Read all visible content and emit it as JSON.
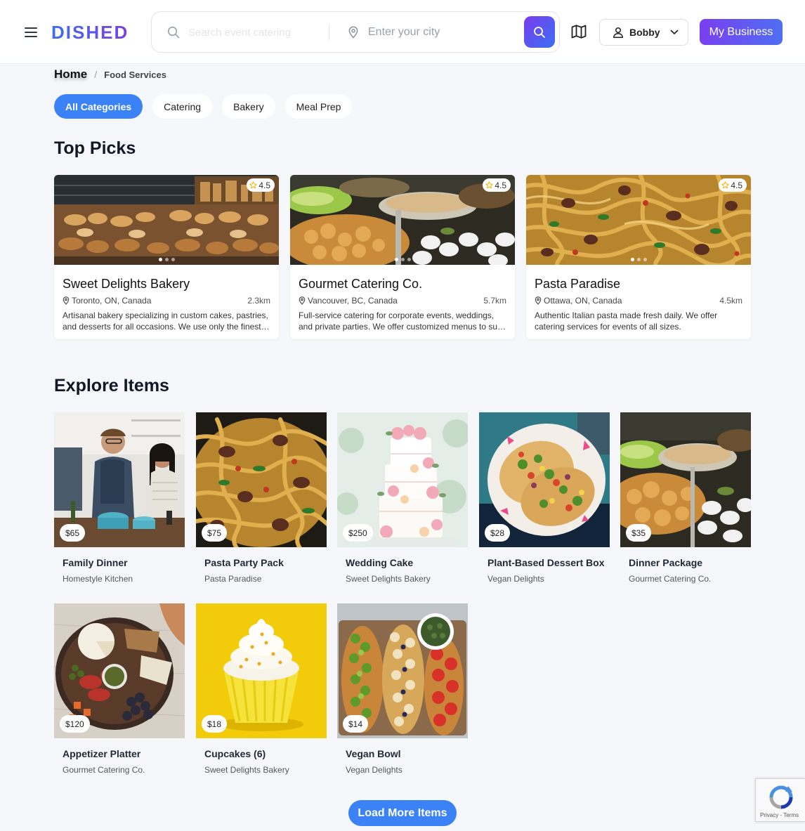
{
  "header": {
    "logo": "DISHED",
    "search_placeholder": "Search event catering",
    "location_placeholder": "Enter your city",
    "user_name": "Bobby",
    "business_button": "My Business"
  },
  "breadcrumb": {
    "home": "Home",
    "separator": "/",
    "current": "Food Services"
  },
  "categories": [
    "All Categories",
    "Catering",
    "Bakery",
    "Meal Prep"
  ],
  "top_picks": {
    "title": "Top Picks",
    "cards": [
      {
        "name": "Sweet Delights Bakery",
        "rating": "4.5",
        "location": "Toronto, ON, Canada",
        "distance": "2.3km",
        "description": "Artisanal bakery specializing in custom cakes, pastries, and desserts for all occasions. We use only the finest ingredients."
      },
      {
        "name": "Gourmet Catering Co.",
        "rating": "4.5",
        "location": "Vancouver, BC, Canada",
        "distance": "5.7km",
        "description": "Full-service catering for corporate events, weddings, and private parties. We offer customized menus to suit every taste."
      },
      {
        "name": "Pasta Paradise",
        "rating": "4.5",
        "location": "Ottawa, ON, Canada",
        "distance": "4.5km",
        "description": "Authentic Italian pasta made fresh daily. We offer catering services for events of all sizes."
      }
    ]
  },
  "explore": {
    "title": "Explore Items",
    "items": [
      {
        "name": "Family Dinner",
        "seller": "Homestyle Kitchen",
        "price": "$65"
      },
      {
        "name": "Pasta Party Pack",
        "seller": "Pasta Paradise",
        "price": "$75"
      },
      {
        "name": "Wedding Cake",
        "seller": "Sweet Delights Bakery",
        "price": "$250"
      },
      {
        "name": "Plant-Based Dessert Box",
        "seller": "Vegan Delights",
        "price": "$28"
      },
      {
        "name": "Dinner Package",
        "seller": "Gourmet Catering Co.",
        "price": "$35"
      },
      {
        "name": "Appetizer Platter",
        "seller": "Gourmet Catering Co.",
        "price": "$120"
      },
      {
        "name": "Cupcakes (6)",
        "seller": "Sweet Delights Bakery",
        "price": "$18"
      },
      {
        "name": "Vegan Bowl",
        "seller": "Vegan Delights",
        "price": "$14"
      }
    ]
  },
  "load_more": "Load More Items",
  "recaptcha": {
    "privacy": "Privacy",
    "separator": " - ",
    "terms": "Terms"
  },
  "icons": {
    "menu": "hamburger-menu-icon",
    "search": "search-icon",
    "location": "map-pin-icon",
    "map": "map-icon",
    "user": "user-icon",
    "chevron": "chevron-down-icon",
    "star": "star-icon"
  },
  "colors": {
    "primary": "#3b82f6",
    "brand_gradient_start": "#3b6ef0",
    "brand_gradient_end": "#7b3fe4",
    "star": "#f5b301"
  }
}
